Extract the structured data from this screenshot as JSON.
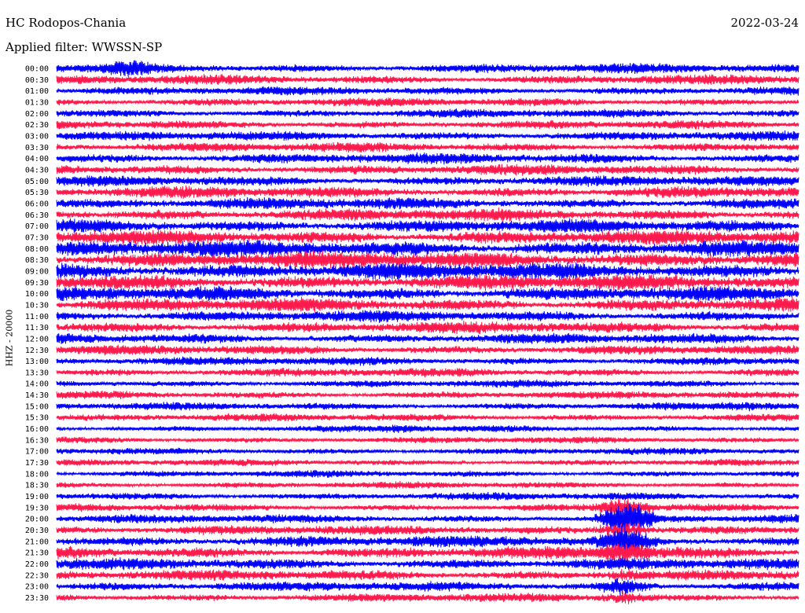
{
  "header": {
    "station": "HC Rodopos-Chania",
    "date": "2022-03-24",
    "filter": "Applied filter: WWSSN-SP"
  },
  "channel_label": "HHZ - 20000",
  "chart_data": {
    "type": "line",
    "title": "HC Rodopos-Chania",
    "subtitle": "Applied filter: WWSSN-SP",
    "ylabel": "HHZ - 20000",
    "xlabel": "",
    "row_labels": [
      "00:00",
      "00:30",
      "01:00",
      "01:30",
      "02:00",
      "02:30",
      "03:00",
      "03:30",
      "04:00",
      "04:30",
      "05:00",
      "05:30",
      "06:00",
      "06:30",
      "07:00",
      "07:30",
      "08:00",
      "08:30",
      "09:00",
      "09:30",
      "10:00",
      "10:30",
      "11:00",
      "11:30",
      "12:00",
      "12:30",
      "13:00",
      "13:30",
      "14:00",
      "14:30",
      "15:00",
      "15:30",
      "16:00",
      "16:30",
      "17:00",
      "17:30",
      "18:00",
      "18:30",
      "19:00",
      "19:30",
      "20:00",
      "20:30",
      "21:00",
      "21:30",
      "22:00",
      "22:30",
      "23:00",
      "23:30"
    ],
    "row_colors": [
      "#0000ff",
      "#ff1a4d"
    ],
    "row_activity": [
      1.0,
      1.0,
      0.9,
      0.9,
      0.9,
      0.9,
      1.0,
      1.0,
      1.1,
      1.1,
      1.1,
      1.2,
      1.2,
      1.3,
      1.4,
      1.5,
      1.7,
      1.8,
      1.8,
      1.6,
      1.5,
      1.4,
      1.2,
      1.2,
      1.1,
      1.0,
      0.9,
      0.9,
      0.8,
      0.8,
      0.8,
      0.8,
      0.7,
      0.7,
      0.7,
      0.7,
      0.7,
      0.7,
      0.8,
      0.8,
      0.9,
      1.0,
      1.2,
      1.3,
      1.2,
      1.1,
      1.0,
      0.9
    ],
    "events": [
      {
        "row": 0,
        "minute": 3,
        "amplitude": 1.8
      },
      {
        "row": 1,
        "minute": 24,
        "amplitude": 1.4
      },
      {
        "row": 30,
        "minute": 28,
        "amplitude": 1.6
      },
      {
        "row": 32,
        "minute": 14,
        "amplitude": 1.7
      },
      {
        "row": 39,
        "minute": 23,
        "amplitude": 3.5
      },
      {
        "row": 40,
        "minute": 23,
        "amplitude": 5.0
      },
      {
        "row": 41,
        "minute": 23,
        "amplitude": 4.5
      },
      {
        "row": 42,
        "minute": 23,
        "amplitude": 3.2
      },
      {
        "row": 43,
        "minute": 23,
        "amplitude": 2.5
      },
      {
        "row": 45,
        "minute": 23,
        "amplitude": 2.2
      },
      {
        "row": 46,
        "minute": 23,
        "amplitude": 2.6
      },
      {
        "row": 47,
        "minute": 23,
        "amplitude": 2.4
      }
    ],
    "minutes_per_row": 30,
    "grid": false,
    "legend": "none"
  }
}
